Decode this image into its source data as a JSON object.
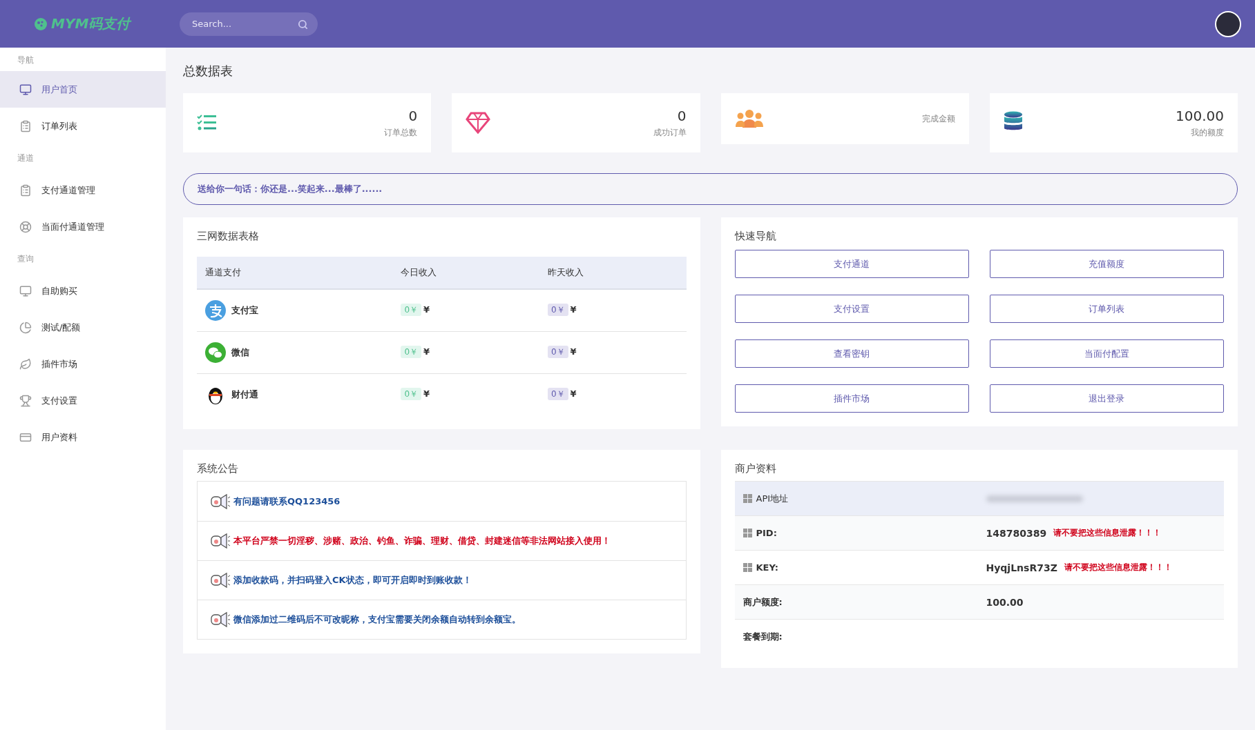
{
  "header": {
    "logo": "MYM码支付",
    "search": {
      "placeholder": "Search..."
    }
  },
  "sidebar": {
    "sections": [
      {
        "title": "导航",
        "items": [
          {
            "label": "用户首页",
            "selected": true
          },
          {
            "label": "订单列表",
            "selected": false
          }
        ]
      },
      {
        "title": "通道",
        "items": [
          {
            "label": "支付通道管理",
            "selected": false
          },
          {
            "label": "当面付通道管理",
            "selected": false
          }
        ]
      },
      {
        "title": "查询",
        "items": [
          {
            "label": "自助购买",
            "selected": false
          },
          {
            "label": "测试/配额",
            "selected": false
          },
          {
            "label": "插件市场",
            "selected": false
          },
          {
            "label": "支付设置",
            "selected": false
          },
          {
            "label": "用户资料",
            "selected": false
          }
        ]
      }
    ]
  },
  "page_title": "总数据表",
  "stats": [
    {
      "value": "0",
      "label": "订单总数"
    },
    {
      "value": "0",
      "label": "成功订单"
    },
    {
      "label": "完成金额"
    },
    {
      "value": "100.00",
      "label": "我的额度"
    }
  ],
  "banner": "送给你一句话：你还是...笑起来...最棒了......",
  "network_table": {
    "title": "三网数据表格",
    "columns": [
      "通道支付",
      "今日收入",
      "昨天收入"
    ],
    "rows": [
      {
        "name": "支付宝",
        "today": "0￥",
        "today_unit": "¥",
        "yesterday": "0￥",
        "yesterday_unit": "¥"
      },
      {
        "name": "微信",
        "today": "0￥",
        "today_unit": "¥",
        "yesterday": "0￥",
        "yesterday_unit": "¥"
      },
      {
        "name": "财付通",
        "today": "0￥",
        "today_unit": "¥",
        "yesterday": "0￥",
        "yesterday_unit": "¥"
      }
    ]
  },
  "quick_nav": {
    "title": "快速导航",
    "buttons": [
      "支付通道",
      "充值额度",
      "支付设置",
      "订单列表",
      "查看密钥",
      "当面付配置",
      "插件市场",
      "退出登录"
    ]
  },
  "notices": {
    "title": "系统公告",
    "items": [
      {
        "text": "有问题请联系QQ123456",
        "color": "#1d4f9a"
      },
      {
        "text": "本平台严禁一切淫秽、涉赌、政治、钓鱼、诈骗、理财、借贷、封建迷信等非法网站接入使用！",
        "color": "#d0021b"
      },
      {
        "text": "添加收款码，并扫码登入CK状态，即可开启即时到账收款！",
        "color": "#1d4f9a"
      },
      {
        "text": "微信添加过二维码后不可改昵称，支付宝需要关闭余额自动转到余额宝。",
        "color": "#1d4f9a"
      }
    ]
  },
  "merchant": {
    "title": "商户资料",
    "rows": [
      {
        "kind": "address",
        "label": "API地址",
        "highlighted": true
      },
      {
        "kind": "secret",
        "label": "PID:",
        "value": "148780389",
        "warning": "请不要把这些信息泄露！！！",
        "highlighted": false
      },
      {
        "kind": "secret",
        "label": "KEY:",
        "value": "HyqjLnsR73Z",
        "warning": "请不要把这些信息泄露！！！",
        "highlighted": false
      },
      {
        "kind": "plain",
        "label": "商户额度:",
        "value": "100.00",
        "highlighted": false
      },
      {
        "kind": "plain",
        "label": "套餐到期:",
        "highlighted": false
      }
    ]
  }
}
